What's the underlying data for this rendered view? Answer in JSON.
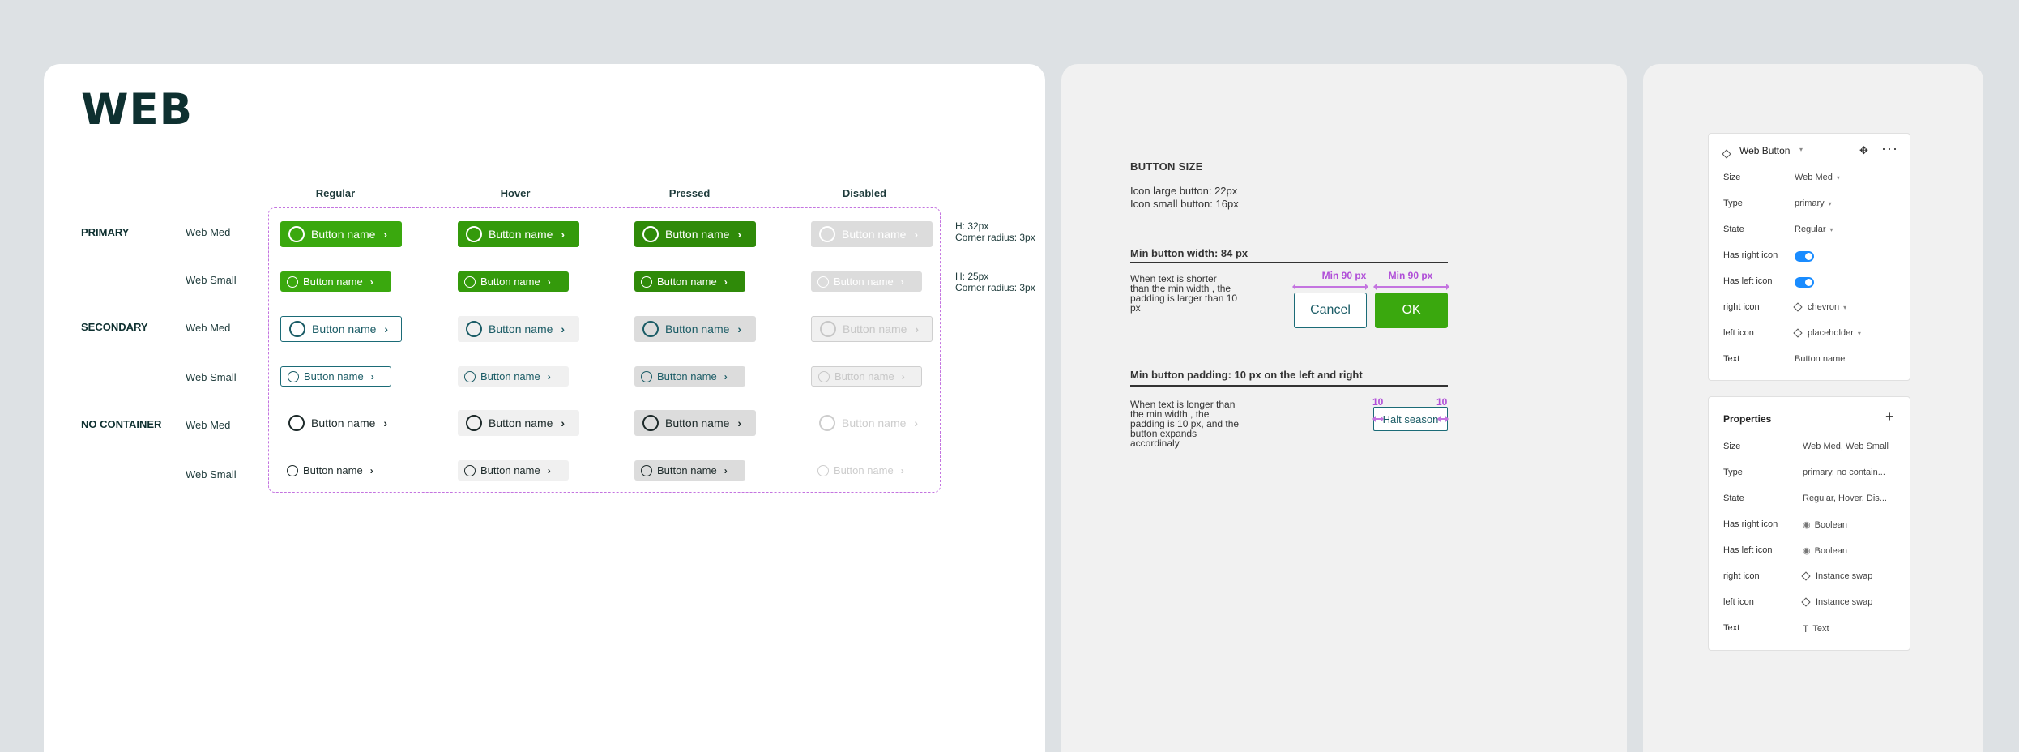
{
  "web": {
    "title": "WEB",
    "columns": [
      "Regular",
      "Hover",
      "Pressed",
      "Disabled"
    ],
    "row_types": [
      "PRIMARY",
      "SECONDARY",
      "NO CONTAINER"
    ],
    "row_sizes": [
      "Web Med",
      "Web Small",
      "Web Med",
      "Web Small",
      "Web Med",
      "Web Small"
    ],
    "button_label": "Button name",
    "notes": {
      "med_height": "H: 32px",
      "med_radius": "Corner radius: 3px",
      "small_height": "H: 25px",
      "small_radius": "Corner radius: 3px"
    },
    "colors": {
      "primary": "#3aa80e",
      "secondary_border": "#1b6b77",
      "spec_outline": "#c474e0"
    }
  },
  "size": {
    "heading": "BUTTON SIZE",
    "icon_large": "Icon large button: 22px",
    "icon_small": "Icon small button: 16px",
    "min_width_title": "Min button width: 84 px",
    "min_width_desc": [
      "When text is shorter",
      "than the min width , the",
      "padding is larger than 10",
      "px"
    ],
    "min_label_1": "Min 90 px",
    "min_label_2": "Min 90 px",
    "cancel": "Cancel",
    "ok": "OK",
    "padding_title": "Min button padding: 10 px on the left and right",
    "padding_desc": [
      "When text is longer than",
      "the min width , the",
      "padding is 10 px, and the",
      "button expands",
      "accordinaly"
    ],
    "pad_left": "10",
    "pad_right": "10",
    "halt": "Halt season"
  },
  "props": {
    "component": {
      "name": "Web Button",
      "rows": [
        {
          "label": "Size",
          "value": "Web Med",
          "kind": "select"
        },
        {
          "label": "Type",
          "value": "primary",
          "kind": "select"
        },
        {
          "label": "State",
          "value": "Regular",
          "kind": "select"
        },
        {
          "label": "Has right icon",
          "value": "",
          "kind": "toggle"
        },
        {
          "label": "Has left icon",
          "value": "",
          "kind": "toggle"
        },
        {
          "label": "right icon",
          "value": "chevron",
          "kind": "instance"
        },
        {
          "label": "left icon",
          "value": "placeholder",
          "kind": "instance"
        },
        {
          "label": "Text",
          "value": "Button name",
          "kind": "text"
        }
      ]
    },
    "properties": {
      "title": "Properties",
      "add": "+",
      "rows": [
        {
          "label": "Size",
          "value": "Web Med, Web Small",
          "icon": ""
        },
        {
          "label": "Type",
          "value": "primary, no contain...",
          "icon": ""
        },
        {
          "label": "State",
          "value": "Regular, Hover, Dis...",
          "icon": ""
        },
        {
          "label": "Has right icon",
          "value": "Boolean",
          "icon": "eye"
        },
        {
          "label": "Has left icon",
          "value": "Boolean",
          "icon": "eye"
        },
        {
          "label": "right icon",
          "value": "Instance swap",
          "icon": "diamond"
        },
        {
          "label": "left icon",
          "value": "Instance swap",
          "icon": "diamond"
        },
        {
          "label": "Text",
          "value": "Text",
          "icon": "text"
        }
      ]
    }
  }
}
